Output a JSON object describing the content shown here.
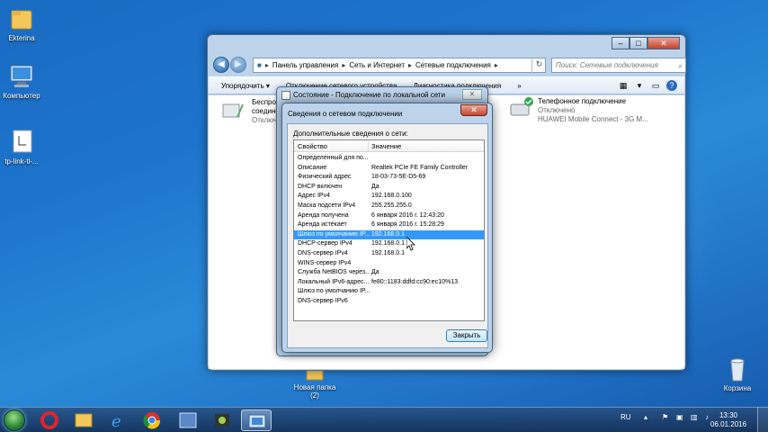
{
  "desktop": {
    "icons": [
      {
        "label": "Ekterina"
      },
      {
        "label": "Компьютер"
      },
      {
        "label": "tp-link-tl-..."
      },
      {
        "label": "Новая папка\n(2)"
      },
      {
        "label": "Корзина"
      }
    ]
  },
  "explorer": {
    "address": [
      "Панель управления",
      "Сеть и Интернет",
      "Сетевые подключения"
    ],
    "search_placeholder": "Поиск: Сетевые подключения",
    "toolbar": [
      "Упорядочить ▾",
      "Отключение сетевого устройства",
      "Диагностика подключения",
      "»"
    ],
    "connections": {
      "left": {
        "line1": "Беспров",
        "line2": "соедине",
        "line3": "Отключе"
      },
      "right": {
        "name": "Телефонное подключение",
        "status": "Отключено",
        "device": "HUAWEI Mobile Connect - 3G M..."
      }
    }
  },
  "status_window": {
    "title": "Состояние - Подключение по локальной сети"
  },
  "dialog": {
    "title": "Сведения о сетевом подключении",
    "section_label": "Дополнительные сведения о сети:",
    "columns": {
      "property": "Свойство",
      "value": "Значение"
    },
    "rows": [
      {
        "k": "Определенный для по...",
        "v": ""
      },
      {
        "k": "Описание",
        "v": "Realtek PCIe FE Family Controller"
      },
      {
        "k": "Физический адрес",
        "v": "18-03-73-5E-D5-69"
      },
      {
        "k": "DHCP включен",
        "v": "Да"
      },
      {
        "k": "Адрес IPv4",
        "v": "192.168.0.100"
      },
      {
        "k": "Маска подсети IPv4",
        "v": "255.255.255.0"
      },
      {
        "k": "Аренда получена",
        "v": "6 января 2016 г. 12:43:20"
      },
      {
        "k": "Аренда истекает",
        "v": "6 января 2016 г. 15:28:29"
      },
      {
        "k": "Шлюз по умолчанию IP...",
        "v": "192.168.0.1"
      },
      {
        "k": "DHCP-сервер IPv4",
        "v": "192.168.0.1"
      },
      {
        "k": "DNS-сервер IPv4",
        "v": "192.168.0.1"
      },
      {
        "k": "WINS-сервер IPv4",
        "v": ""
      },
      {
        "k": "Служба NetBIOS через...",
        "v": "Да"
      },
      {
        "k": "Локальный IPv6-адрес...",
        "v": "fe80::1183:ddfd:cc90:ec10%13"
      },
      {
        "k": "Шлюз по умолчанию IP...",
        "v": ""
      },
      {
        "k": "DNS-сервер IPv6",
        "v": ""
      }
    ],
    "selected_row": 8,
    "close_button": "Закрыть"
  },
  "taskbar": {
    "lang": "RU",
    "time": "13:30",
    "date": "06.01.2016"
  }
}
